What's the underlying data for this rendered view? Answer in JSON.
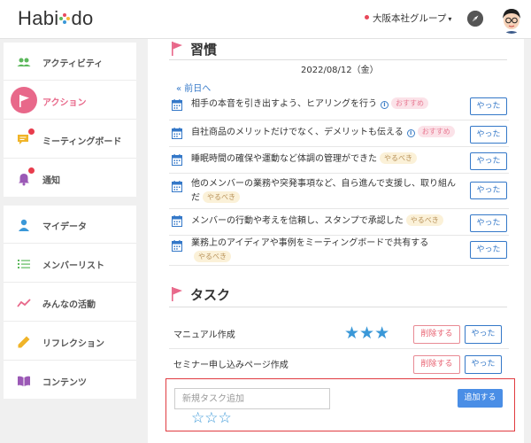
{
  "header": {
    "logo_left": "Habi",
    "logo_right": "do",
    "group": "大阪本社グループ",
    "colors": {
      "accent": "#e8688a",
      "primary": "#3478c8",
      "danger": "#e03b40"
    }
  },
  "sidebar": {
    "primary": [
      {
        "label": "アクティビティ",
        "icon": "people-icon",
        "color": "#5cb85c"
      },
      {
        "label": "アクション",
        "icon": "flag-icon",
        "active": true
      },
      {
        "label": "ミーティングボード",
        "icon": "chat-icon",
        "color": "#f0b429",
        "badge": true
      },
      {
        "label": "通知",
        "icon": "bell-icon",
        "color": "#9b59b6",
        "badge": true
      }
    ],
    "secondary": [
      {
        "label": "マイデータ",
        "icon": "user-icon",
        "color": "#3a98d8"
      },
      {
        "label": "メンバーリスト",
        "icon": "list-icon",
        "color": "#5cb85c"
      },
      {
        "label": "みんなの活動",
        "icon": "trend-icon",
        "color": "#e8688a"
      },
      {
        "label": "リフレクション",
        "icon": "pencil-icon",
        "color": "#f0b429"
      },
      {
        "label": "コンテンツ",
        "icon": "book-icon",
        "color": "#9b59b6"
      }
    ]
  },
  "habits": {
    "title": "習慣",
    "prev_label": "« 前日へ",
    "date": "2022/08/12（金）",
    "items": [
      {
        "text": "相手の本音を引き出すよう、ヒアリングを行う",
        "info": true,
        "tag": "おすすめ",
        "tag_type": "rec",
        "button": "やった"
      },
      {
        "text": "自社商品のメリットだけでなく、デメリットも伝える",
        "info": true,
        "tag": "おすすめ",
        "tag_type": "rec",
        "button": "やった"
      },
      {
        "text": "睡眠時間の確保や運動など体調の管理ができた",
        "info": false,
        "tag": "やるべき",
        "tag_type": "must",
        "button": "やった"
      },
      {
        "text": "他のメンバーの業務や突発事項など、自ら進んで支援し、取り組んだ",
        "info": false,
        "tag": "やるべき",
        "tag_type": "must",
        "button": "やった"
      },
      {
        "text": "メンバーの行動や考えを信頼し、スタンプで承認した",
        "info": false,
        "tag": "やるべき",
        "tag_type": "must",
        "button": "やった"
      },
      {
        "text": "業務上のアイディアや事例をミーティングボードで共有する",
        "info": false,
        "tag": "やるべき",
        "tag_type": "must",
        "button": "やった"
      }
    ]
  },
  "tasks": {
    "title": "タスク",
    "items": [
      {
        "name": "マニュアル作成",
        "stars": "★★★",
        "delete_label": "削除する",
        "done_label": "やった"
      },
      {
        "name": "セミナー申し込みページ作成",
        "stars": "",
        "delete_label": "削除する",
        "done_label": "やった"
      }
    ],
    "new_task": {
      "placeholder": "新規タスク追加",
      "value": "",
      "stars": "☆☆☆",
      "add_label": "追加する"
    }
  }
}
